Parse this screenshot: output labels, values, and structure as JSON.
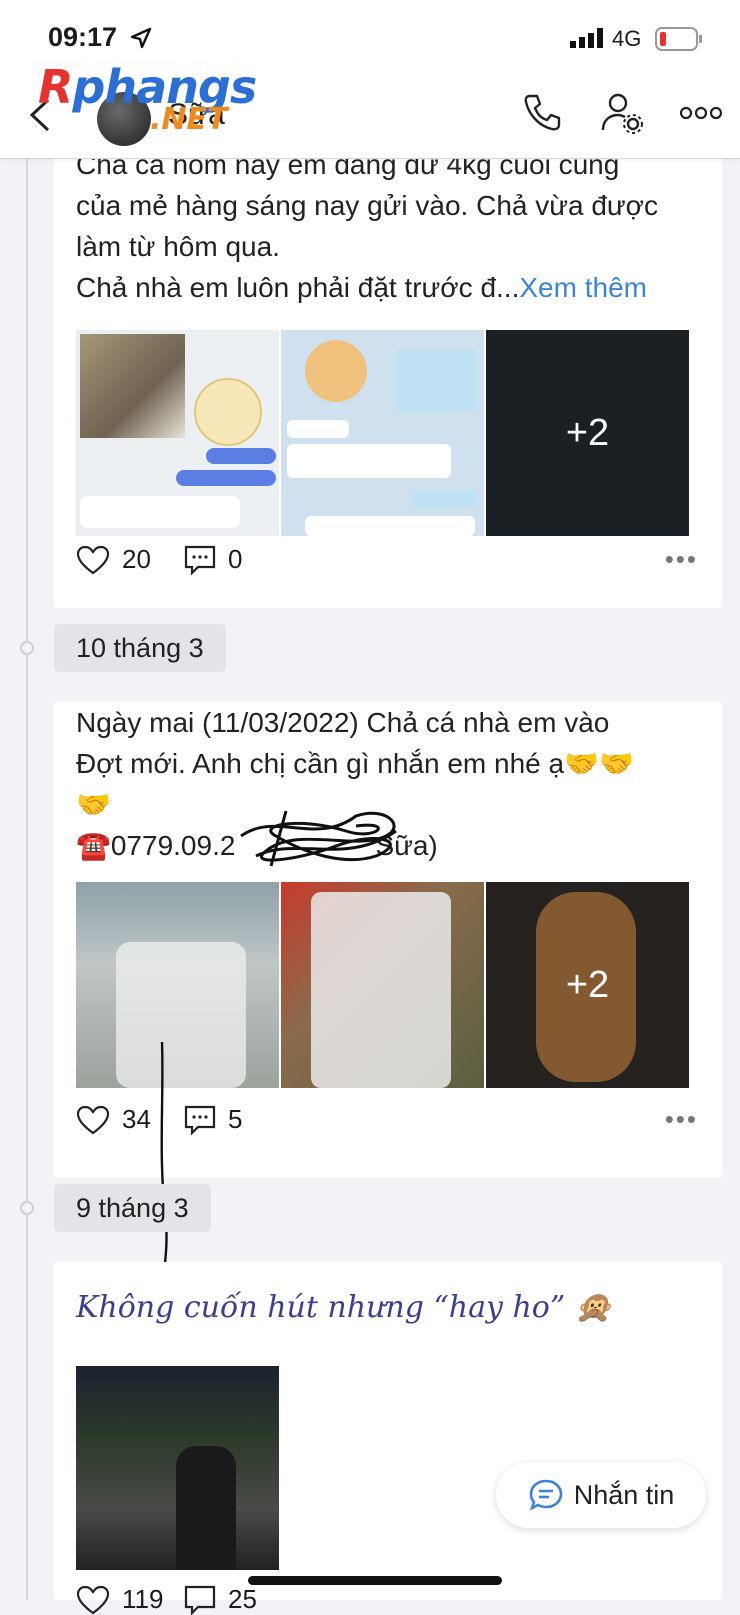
{
  "status": {
    "time": "09:17",
    "network": "4G"
  },
  "header": {
    "title": "Sữa",
    "watermark_a": "R",
    "watermark_b": "phangs",
    "watermark_c": ".NET"
  },
  "posts": [
    {
      "text_lines": [
        "Chả cá hôm nay em đang dư 4kg cuối cùng",
        "của mẻ hàng sáng nay gửi vào. Chả vừa được",
        "làm từ hôm qua.",
        "Chả nhà em luôn phải đặt trước đ..."
      ],
      "more_label": "Xem thêm",
      "image_more": "+2",
      "likes": "20",
      "comments": "0"
    },
    {
      "date": "10 tháng 3",
      "text_lines": [
        "Ngày mai (11/03/2022) Chả cá nhà em vào",
        "Đợt mới. Anh chị cần gì nhắn em nhé ạ🤝🤝",
        "🤝",
        "☎️0779.09.2",
        "Sữa)"
      ],
      "image_more": "+2",
      "likes": "34",
      "comments": "5"
    },
    {
      "date": "9 tháng 3",
      "title": "Không cuốn hút nhưng “hay ho” 🙊",
      "likes": "119",
      "comments": "25"
    }
  ],
  "message_button": {
    "label": "Nhắn tin"
  },
  "colors": {
    "link": "#3d84d8",
    "fancy": "#3c3f8f"
  }
}
